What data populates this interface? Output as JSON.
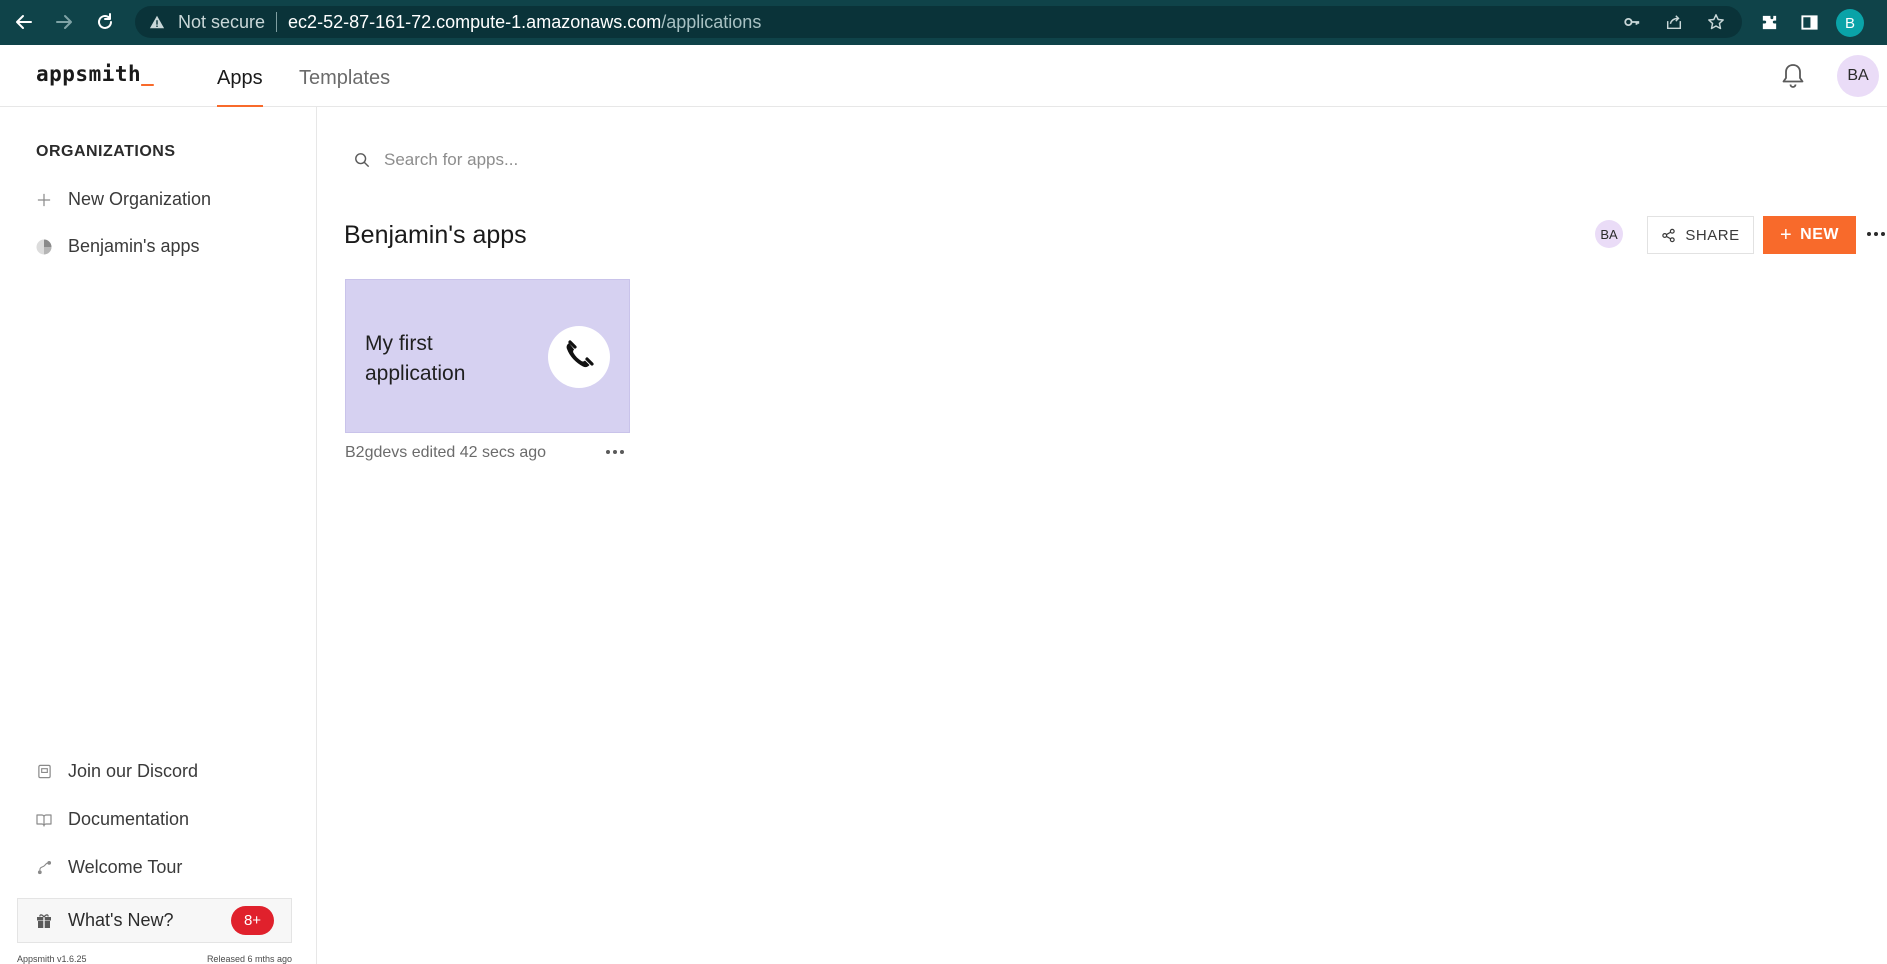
{
  "browser": {
    "not_secure": "Not secure",
    "url_host": "ec2-52-87-161-72.compute-1.amazonaws.com",
    "url_path": "/applications",
    "profile_initial": "B"
  },
  "header": {
    "logo": "appsmith",
    "logo_cursor": "_",
    "tabs": [
      {
        "label": "Apps"
      },
      {
        "label": "Templates"
      }
    ],
    "avatar": "BA"
  },
  "sidebar": {
    "heading": "ORGANIZATIONS",
    "items": [
      {
        "label": "New Organization",
        "icon": "plus-icon"
      },
      {
        "label": "Benjamin's apps",
        "icon": "org-logo-icon"
      }
    ],
    "footer_items": [
      {
        "label": "Join our Discord",
        "icon": "discord-icon"
      },
      {
        "label": "Documentation",
        "icon": "book-icon"
      },
      {
        "label": "Welcome Tour",
        "icon": "route-icon"
      }
    ],
    "whats_new": {
      "label": "What's New?",
      "badge": "8+"
    },
    "version": "Appsmith v1.6.25",
    "released": "Released 6 mths ago"
  },
  "main": {
    "search_placeholder": "Search for apps...",
    "section_title": "Benjamin's apps",
    "member_avatar": "BA",
    "share_label": "SHARE",
    "new_label": "NEW",
    "apps": [
      {
        "name": "My first application",
        "edited": "B2gdevs edited 42 secs ago",
        "icon": "phone-icon",
        "color": "#d6d1f1"
      }
    ]
  },
  "colors": {
    "accent": "#f86a2b",
    "browser_bar": "#0f4349",
    "badge": "#e0212c"
  }
}
